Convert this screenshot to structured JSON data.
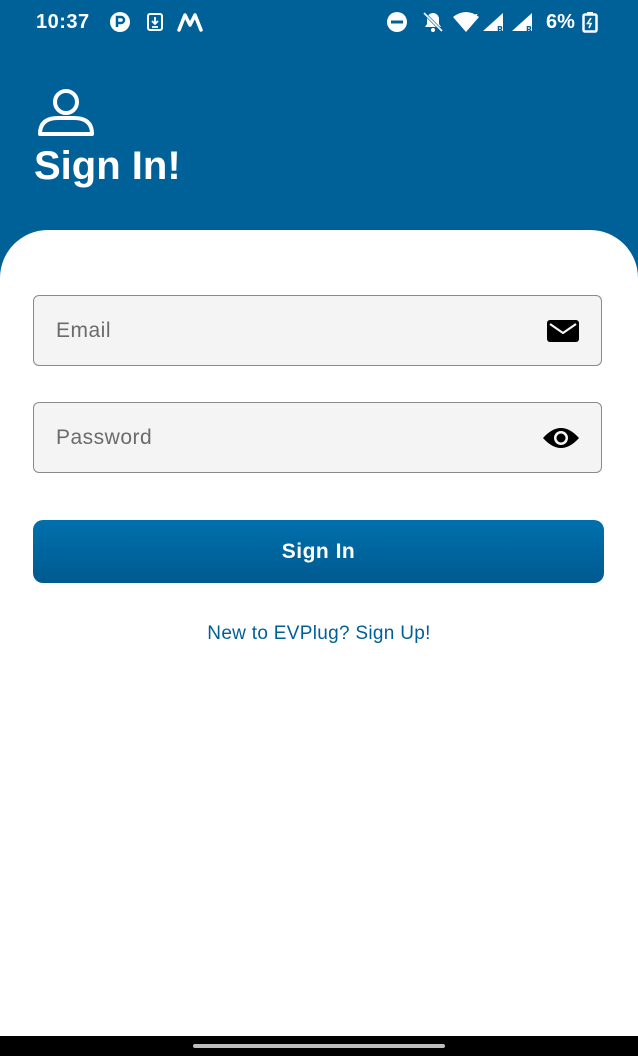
{
  "status_bar": {
    "time": "10:37",
    "battery": "6%",
    "icons": [
      "app-notification-icon",
      "download-icon",
      "m-app-icon",
      "do-not-disturb-icon",
      "muted-bell-icon",
      "wifi-icon",
      "signal-icon",
      "signal-icon",
      "battery-icon"
    ]
  },
  "header": {
    "icon": "user-icon",
    "title": "Sign In!"
  },
  "form": {
    "email": {
      "placeholder": "Email",
      "value": "",
      "icon": "mail-icon"
    },
    "password": {
      "placeholder": "Password",
      "value": "",
      "icon": "eye-icon"
    },
    "submit_label": "Sign In",
    "signup_link": "New to EVPlug? Sign Up!"
  },
  "colors": {
    "primary": "#006199",
    "link": "#005f96",
    "field_bg": "#f4f4f4"
  }
}
